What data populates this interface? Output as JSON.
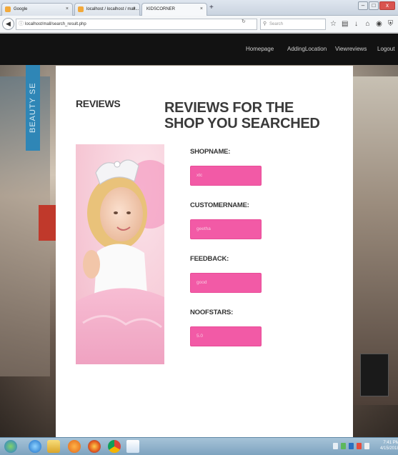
{
  "browser": {
    "tabs": [
      {
        "label": "Google",
        "favicon_color": "#f2a93b",
        "active": false
      },
      {
        "label": "localhost / localhost / mall... ",
        "favicon_color": "#f2a93b",
        "active": false
      },
      {
        "label": "KIDSCORNER",
        "favicon_color": "",
        "active": true
      }
    ],
    "close_glyph": "×",
    "new_tab_glyph": "+",
    "url": "localhost/mall/search_result.php",
    "search_placeholder": "Search",
    "toolbar_icons": [
      "star-icon",
      "bookmarks-icon",
      "download-icon",
      "home-icon",
      "pocket-icon",
      "shield-icon",
      "menu-icon"
    ],
    "window_controls": {
      "minimize": "–",
      "maximize": "□",
      "close": "x"
    }
  },
  "site_nav": {
    "items": [
      "Homepage",
      "AddingLocation",
      "Viewreviews",
      "Logout"
    ]
  },
  "page": {
    "side_heading": "REVIEWS",
    "title": "REVIEWS FOR THE SHOP YOU SEARCHED",
    "background_sign": "BEAUTY SE"
  },
  "fields": [
    {
      "label": "SHOPNAME:",
      "value": "xtc"
    },
    {
      "label": "CUSTOMERNAME:",
      "value": "geetha"
    },
    {
      "label": "FEEDBACK:",
      "value": "good"
    },
    {
      "label": "NOOFSTARS:",
      "value": "5.0"
    }
  ],
  "colors": {
    "nav_bg": "#121212",
    "field_pink": "#f25aa6",
    "card_bg": "#ffffff"
  },
  "taskbar": {
    "icons": [
      "start-orb-icon",
      "ie-icon",
      "explorer-folder-icon",
      "media-player-icon",
      "firefox-icon",
      "chrome-icon",
      "notepad-icon"
    ],
    "clock_time": "7:41 PM",
    "clock_date": "4/15/2018"
  }
}
